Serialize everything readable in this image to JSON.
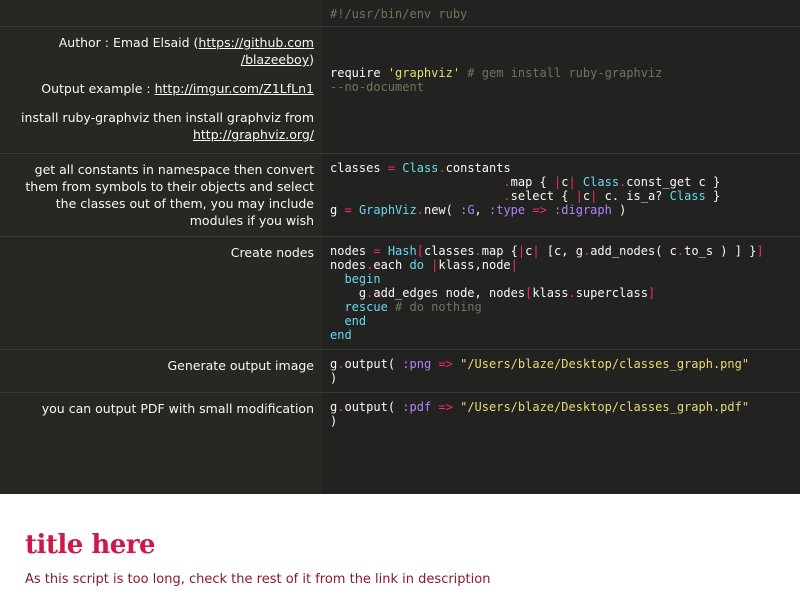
{
  "rows": [
    {
      "doc": [],
      "code": "shebang"
    },
    {
      "doc": {
        "author_prefix": "Author : Emad Elsaid (",
        "author_link_1": "https://github.com",
        "author_link_2": "/blazeeboy",
        "author_suffix": ")",
        "output_prefix": "Output example : ",
        "output_link": "http://imgur.com/Z1LfLn1",
        "install_text": "install ruby-graphviz then install graphviz from",
        "install_link": "http://graphviz.org/"
      }
    },
    {
      "doc": {
        "text": "get all constants in namespace then convert them from symbols to their objects and select the classes out of them, you may include modules if you wish"
      }
    },
    {
      "doc": {
        "text": "Create nodes"
      }
    },
    {
      "doc": {
        "text": "Generate output image"
      }
    },
    {
      "doc": {
        "text": "you can output PDF with small modification"
      }
    }
  ],
  "code": {
    "shebang": "#!/usr/bin/env ruby",
    "require_kw": "require",
    "require_str": "'graphviz'",
    "require_comment_1": "# gem install ruby-graphviz",
    "require_comment_2": "--no-document",
    "classes_var": "classes",
    "const_class": "Class",
    "constants": "constants",
    "map_line_a": "map { ",
    "map_line_b": "c",
    "map_line_c": "const_get c }",
    "select_line_a": "select { ",
    "select_line_b": "c. is_a? ",
    "select_line_d": " }",
    "g_var": "g",
    "graphviz": "GraphViz",
    "new_call": "new( ",
    "sym_g": ":G",
    "sym_type": ":type",
    "sym_digraph": ":digraph",
    "close_paren": ")",
    "nodes_var": "nodes",
    "hash": "Hash",
    "nodes_map_a": "classes",
    "nodes_map_b": "map {",
    "nodes_map_c": " [c, g",
    "nodes_map_d": "add_nodes( c",
    "nodes_map_e": "to_s ) ]",
    "each_a": "nodes",
    "each_b": "each ",
    "each_do": "do",
    "each_c": "klass,node",
    "begin_kw": "begin",
    "edges_a": "g",
    "edges_b": "add_edges node, nodes",
    "edges_c": "klass",
    "edges_d": "superclass",
    "rescue_kw": "rescue",
    "rescue_comment": "# do nothing",
    "end_kw": "end",
    "output_a": "g",
    "output_b": "output( ",
    "sym_png": ":png",
    "png_path": "\"/Users/blaze/Desktop/classes_graph.png\"",
    "sym_pdf": ":pdf",
    "pdf_path": "\"/Users/blaze/Desktop/classes_graph.pdf\""
  },
  "footer": {
    "title": "title here",
    "description": "As this script is too long, check the rest of it from the link in description"
  }
}
